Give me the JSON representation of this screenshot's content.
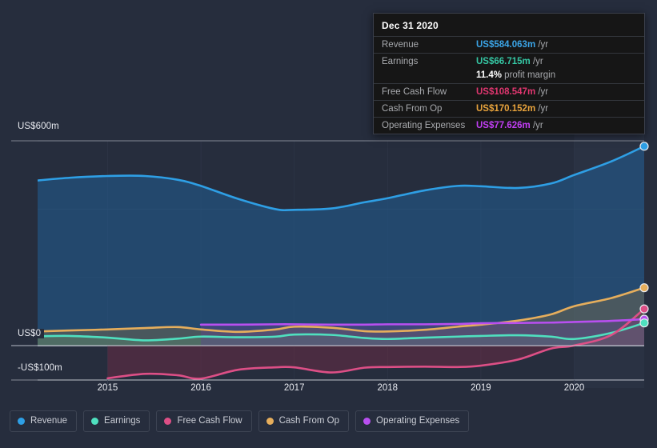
{
  "chart_data": {
    "type": "area",
    "title": "",
    "xlabel": "",
    "ylabel": "",
    "grid": true,
    "legend_position": "bottom-left",
    "xlim": [
      2014.25,
      2020.75
    ],
    "ylim": [
      -100,
      600
    ],
    "y_unit": "US$m",
    "y_ticks": [
      {
        "value": 600,
        "label": "US$600m"
      },
      {
        "value": 0,
        "label": "US$0"
      },
      {
        "value": -100,
        "label": "-US$100m"
      }
    ],
    "y_gridlines": [
      600,
      400,
      200,
      0,
      -100
    ],
    "x_ticks": [
      {
        "value": 2015,
        "label": "2015"
      },
      {
        "value": 2016,
        "label": "2016"
      },
      {
        "value": 2017,
        "label": "2017"
      },
      {
        "value": 2018,
        "label": "2018"
      },
      {
        "value": 2019,
        "label": "2019"
      },
      {
        "value": 2020,
        "label": "2020"
      }
    ],
    "series": [
      {
        "name": "Revenue",
        "color": "#2e9fe5",
        "fill": "rgba(33,95,150,0.55)",
        "x": [
          2014.25,
          2014.6,
          2015.0,
          2015.4,
          2015.75,
          2016.0,
          2016.4,
          2016.8,
          2017.0,
          2017.4,
          2017.75,
          2018.0,
          2018.4,
          2018.75,
          2019.0,
          2019.4,
          2019.75,
          2020.0,
          2020.4,
          2020.75
        ],
        "values": [
          484,
          492,
          497,
          497,
          486,
          468,
          430,
          400,
          398,
          402,
          420,
          432,
          455,
          468,
          467,
          462,
          475,
          500,
          540,
          584
        ]
      },
      {
        "name": "Earnings",
        "color": "#4fe0bf",
        "fill": "rgba(60,150,135,0.45)",
        "x": [
          2014.25,
          2014.6,
          2015.0,
          2015.4,
          2015.75,
          2016.0,
          2016.4,
          2016.8,
          2017.0,
          2017.4,
          2017.75,
          2018.0,
          2018.4,
          2018.75,
          2019.0,
          2019.4,
          2019.75,
          2020.0,
          2020.4,
          2020.75
        ],
        "values": [
          28,
          29,
          24,
          16,
          21,
          27,
          25,
          27,
          33,
          32,
          23,
          20,
          24,
          27,
          29,
          31,
          27,
          20,
          38,
          67
        ]
      },
      {
        "name": "Free Cash Flow",
        "color": "#dd4f86",
        "fill": "rgba(120,45,70,0.45)",
        "x": [
          2015.0,
          2015.4,
          2015.75,
          2016.0,
          2016.4,
          2016.8,
          2017.0,
          2017.4,
          2017.75,
          2018.0,
          2018.4,
          2018.75,
          2019.0,
          2019.4,
          2019.75,
          2020.0,
          2020.4,
          2020.75
        ],
        "values": [
          -95,
          -82,
          -86,
          -96,
          -70,
          -63,
          -63,
          -78,
          -64,
          -62,
          -61,
          -62,
          -58,
          -40,
          -8,
          1,
          32,
          108
        ]
      },
      {
        "name": "Cash From Op",
        "color": "#e6ae5c",
        "fill": "rgba(130,110,70,0.40)",
        "x": [
          2014.25,
          2014.6,
          2015.0,
          2015.4,
          2015.75,
          2016.0,
          2016.4,
          2016.8,
          2017.0,
          2017.4,
          2017.75,
          2018.0,
          2018.4,
          2018.75,
          2019.0,
          2019.4,
          2019.75,
          2020.0,
          2020.4,
          2020.75
        ],
        "values": [
          42,
          45,
          48,
          52,
          55,
          48,
          41,
          48,
          56,
          53,
          43,
          42,
          47,
          56,
          62,
          74,
          92,
          116,
          140,
          170
        ]
      },
      {
        "name": "Operating Expenses",
        "color": "#b84ff0",
        "fill": "rgba(95,70,140,0.45)",
        "x": [
          2016.0,
          2016.4,
          2016.8,
          2017.0,
          2017.4,
          2017.75,
          2018.0,
          2018.4,
          2018.75,
          2019.0,
          2019.4,
          2019.75,
          2020.0,
          2020.4,
          2020.75
        ],
        "values": [
          62,
          62,
          63,
          63,
          62,
          62,
          63,
          63,
          64,
          66,
          67,
          68,
          70,
          73,
          78
        ]
      }
    ],
    "end_markers": [
      {
        "series": "Revenue",
        "x": 2020.75,
        "value": 584,
        "color": "#2e9fe5"
      },
      {
        "series": "Cash From Op",
        "x": 2020.75,
        "value": 170,
        "color": "#e6ae5c"
      },
      {
        "series": "Free Cash Flow",
        "x": 2020.75,
        "value": 108,
        "color": "#dd4f86"
      },
      {
        "series": "Operating Expenses",
        "x": 2020.75,
        "value": 78,
        "color": "#b84ff0"
      },
      {
        "series": "Earnings",
        "x": 2020.75,
        "value": 67,
        "color": "#4fe0bf"
      }
    ]
  },
  "axis": {
    "y_600": "US$600m",
    "y_0": "US$0",
    "y_neg100": "-US$100m",
    "x_labels": [
      "2015",
      "2016",
      "2017",
      "2018",
      "2019",
      "2020"
    ]
  },
  "tooltip": {
    "date": "Dec 31 2020",
    "rows": [
      {
        "key": "Revenue",
        "value": "US$584.063m",
        "unit": "/yr",
        "color": "#3ba5e8"
      },
      {
        "key": "Earnings",
        "value": "US$66.715m",
        "unit": "/yr",
        "color": "#35c7a4"
      },
      {
        "key": "Free Cash Flow",
        "value": "US$108.547m",
        "unit": "/yr",
        "color": "#e0366f"
      },
      {
        "key": "Cash From Op",
        "value": "US$170.152m",
        "unit": "/yr",
        "color": "#e8a33c"
      },
      {
        "key": "Operating Expenses",
        "value": "US$77.626m",
        "unit": "/yr",
        "color": "#c23ef5"
      }
    ],
    "margin_value": "11.4%",
    "margin_label": "profit margin"
  },
  "legend": {
    "items": [
      {
        "label": "Revenue",
        "color": "#2e9fe5"
      },
      {
        "label": "Earnings",
        "color": "#4fe0bf"
      },
      {
        "label": "Free Cash Flow",
        "color": "#dd4f86"
      },
      {
        "label": "Cash From Op",
        "color": "#e6ae5c"
      },
      {
        "label": "Operating Expenses",
        "color": "#b84ff0"
      }
    ]
  },
  "colors": {
    "background": "#262d3d",
    "gridline": "#3a4152",
    "axis_line": "#c8ccd6",
    "tooltip_bg": "#161616"
  }
}
